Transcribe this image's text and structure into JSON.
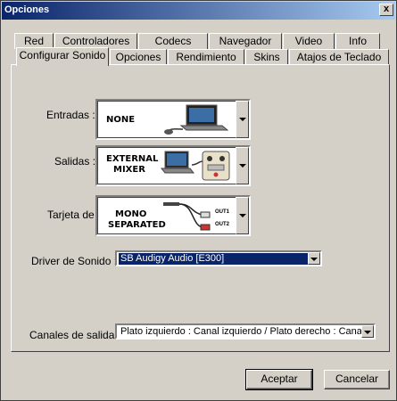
{
  "window": {
    "title": "Opciones",
    "close_label": "x"
  },
  "tabs_row1": [
    "Red",
    "Controladores",
    "Codecs",
    "Navegador",
    "Video",
    "Info"
  ],
  "tabs_row2": [
    "Configurar Sonido",
    "Opciones",
    "Rendimiento",
    "Skins",
    "Atajos de Teclado"
  ],
  "active_tab": "Configurar Sonido",
  "fields": {
    "entradas": {
      "label": "Entradas :",
      "value": "NONE"
    },
    "salidas": {
      "label": "Salidas :",
      "value_line1": "EXTERNAL",
      "value_line2": "MIXER"
    },
    "tarjeta": {
      "label": "Tarjeta de",
      "value_line1": "MONO",
      "value_line2": "SEPARATED",
      "out1": "OUT1",
      "out2": "OUT2"
    },
    "driver": {
      "label": "Driver de Sonido :",
      "value": "SB Audigy Audio [E300]"
    },
    "canales": {
      "label": "Canales de salida :",
      "value": "Plato izquierdo : Canal izquierdo / Plato derecho : Canal d"
    }
  },
  "buttons": {
    "accept": "Aceptar",
    "cancel": "Cancelar"
  },
  "colors": {
    "titlebar": "#0a246a",
    "face": "#d4d0c8",
    "selection": "#0a246a"
  },
  "icons": [
    "close-icon",
    "dropdown-arrow-icon",
    "laptop-turntable-icon",
    "laptop-mixer-icon",
    "rca-cable-icon"
  ]
}
